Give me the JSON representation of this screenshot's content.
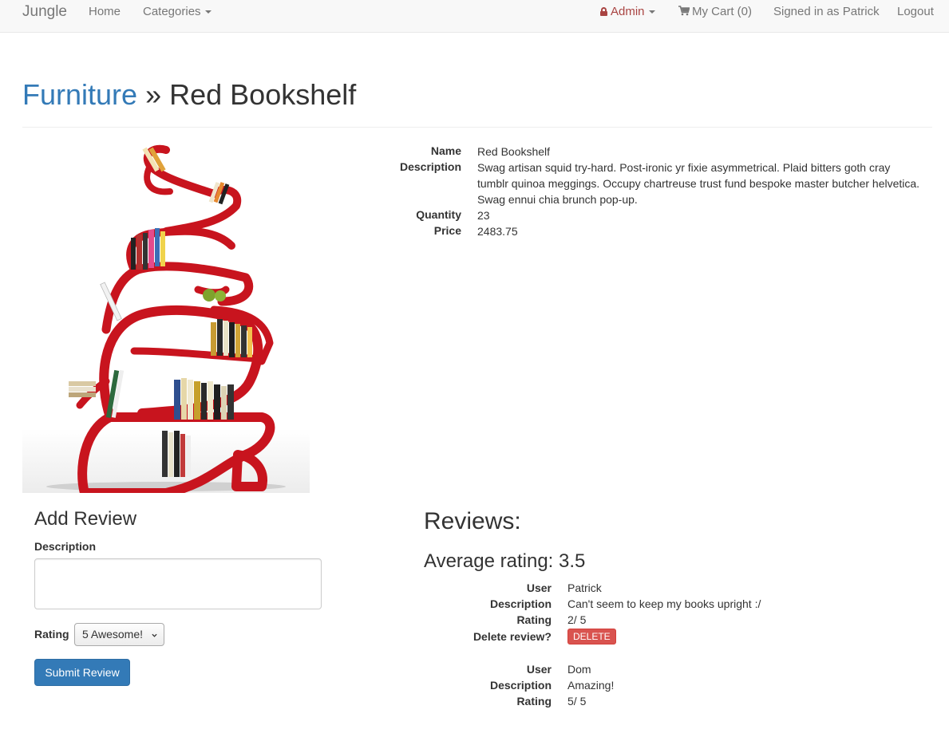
{
  "navbar": {
    "brand": "Jungle",
    "home": "Home",
    "categories": "Categories",
    "admin": "Admin",
    "cart": "My Cart (0)",
    "signed_in": "Signed in as Patrick",
    "logout": "Logout"
  },
  "breadcrumb": {
    "category": "Furniture",
    "separator": "»",
    "product": "Red Bookshelf"
  },
  "product": {
    "labels": {
      "name": "Name",
      "description": "Description",
      "quantity": "Quantity",
      "price": "Price"
    },
    "name": "Red Bookshelf",
    "description_lines": [
      "Swag artisan squid try-hard. Post-ironic yr fixie asymmetrical. Plaid bitters goth cray",
      "tumblr quinoa meggings. Occupy chartreuse trust fund bespoke master butcher helvetica.",
      "Swag ennui chia brunch pop-up."
    ],
    "quantity": "23",
    "price": "2483.75"
  },
  "add_review": {
    "title": "Add Review",
    "description_label": "Description",
    "description_value": "",
    "rating_label": "Rating",
    "rating_selected": "5 Awesome!",
    "submit": "Submit Review"
  },
  "reviews": {
    "title": "Reviews:",
    "average": "Average rating: 3.5",
    "labels": {
      "user": "User",
      "description": "Description",
      "rating": "Rating",
      "delete": "Delete review?"
    },
    "delete_button": "DELETE",
    "items": [
      {
        "user": "Patrick",
        "description": "Can't seem to keep my books upright :/",
        "rating": "2/ 5"
      },
      {
        "user": "Dom",
        "description": "Amazing!",
        "rating": "5/ 5"
      }
    ]
  },
  "colors": {
    "link": "#337ab7",
    "admin": "#a94442",
    "primary_button": "#337ab7",
    "danger_button": "#d9534f",
    "bookshelf": "#c8141e"
  }
}
